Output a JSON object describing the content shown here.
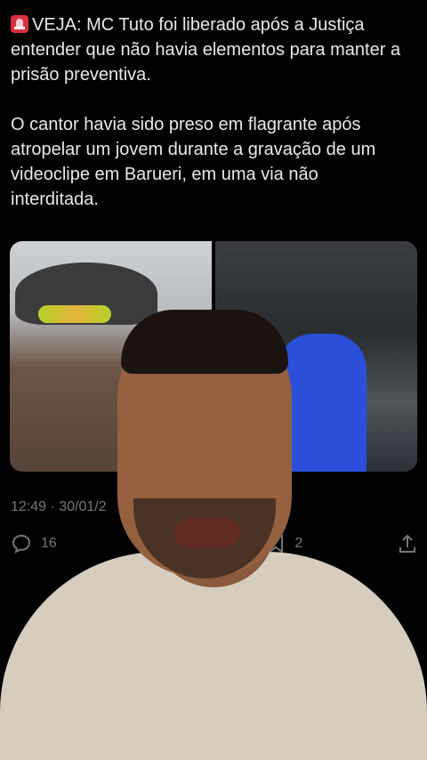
{
  "tweet": {
    "paragraph_1": "VEJA: MC Tuto foi liberado após a Justiça\nentender que não havia elementos para manter a\nprisão preventiva.",
    "paragraph_2": "O cantor havia sido preso em flagrante após\natropelar um jovem durante a gravação de um\nvideoclipe em Barueri, em uma via não\ninterditada.",
    "timestamp": "12:49 · 30/01/2",
    "replies": "16",
    "bookmarks": "2",
    "emoji": "siren-emoji"
  },
  "colors": {
    "background": "#000000",
    "text": "#e7e9ea",
    "muted": "#71767b"
  },
  "icons": {
    "reply": "reply-icon",
    "retweet": "retweet-icon",
    "bookmark": "bookmark-icon",
    "share": "share-icon"
  }
}
